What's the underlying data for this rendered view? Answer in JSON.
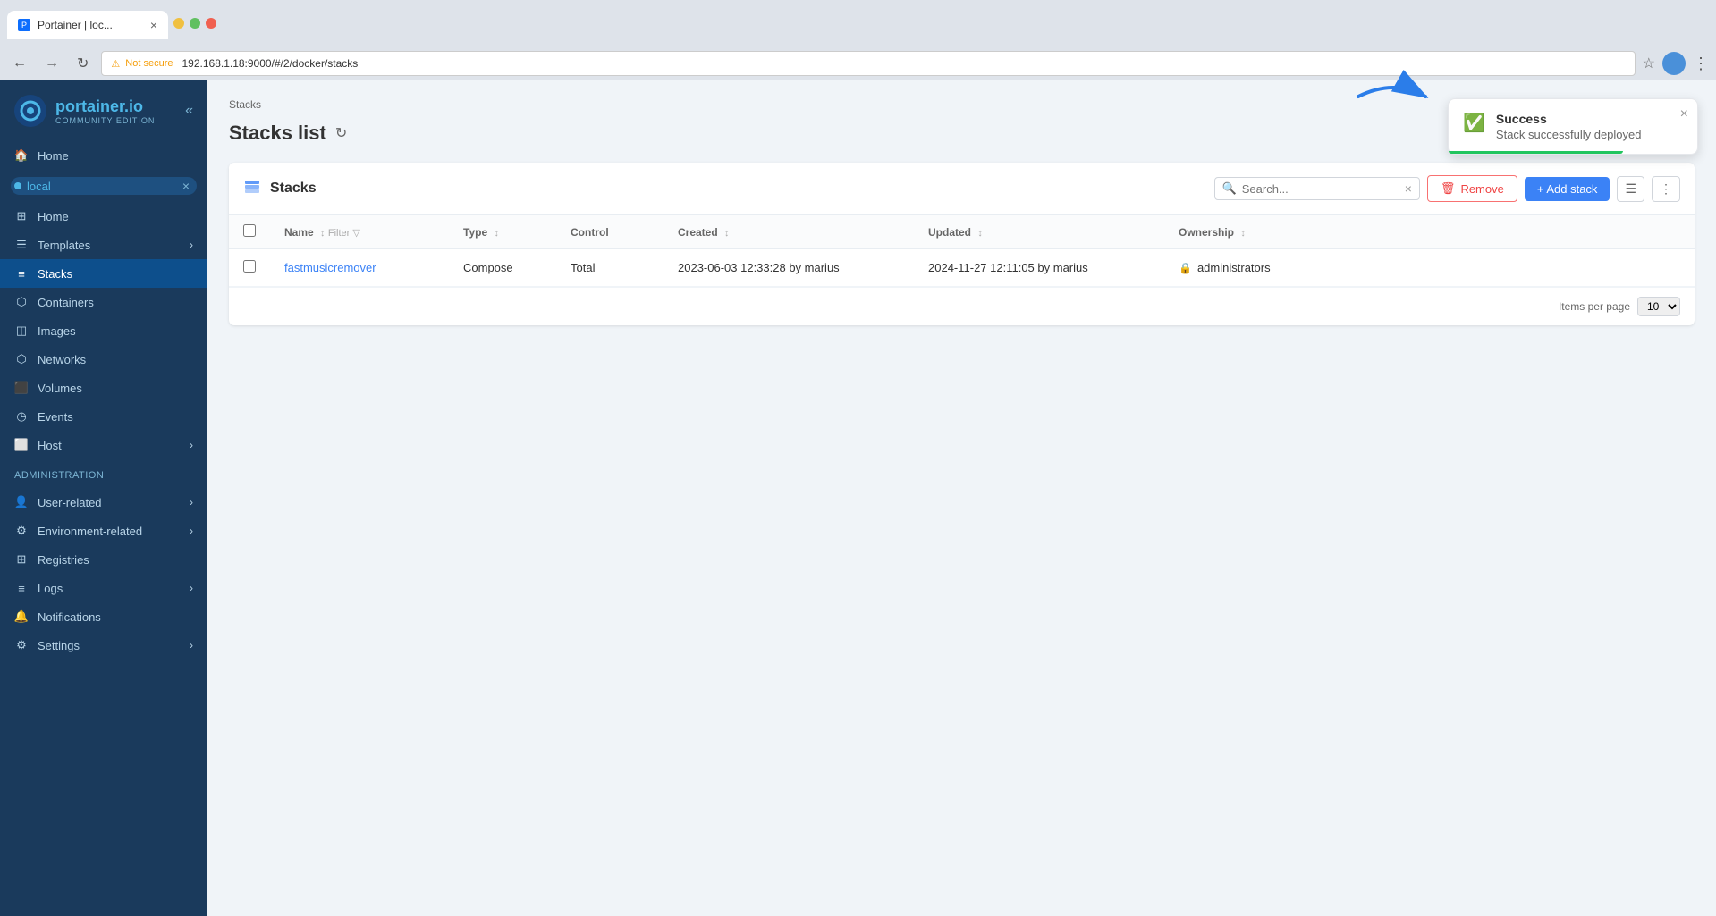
{
  "browser": {
    "tab_title": "Portainer | loc...",
    "url": "192.168.1.18:9000/#/2/docker/stacks",
    "security_label": "Not secure"
  },
  "sidebar": {
    "logo_name": "portainer.io",
    "logo_sub": "Community Edition",
    "env_name": "local",
    "home_label": "Home",
    "templates_label": "Templates",
    "stacks_label": "Stacks",
    "containers_label": "Containers",
    "images_label": "Images",
    "networks_label": "Networks",
    "volumes_label": "Volumes",
    "events_label": "Events",
    "host_label": "Host",
    "admin_label": "Administration",
    "user_related_label": "User-related",
    "env_related_label": "Environment-related",
    "registries_label": "Registries",
    "logs_label": "Logs",
    "notifications_label": "Notifications",
    "settings_label": "Settings"
  },
  "page": {
    "breadcrumb": "Stacks",
    "title": "Stacks list"
  },
  "panel": {
    "title": "Stacks",
    "search_placeholder": "Search...",
    "remove_label": "Remove",
    "add_stack_label": "+ Add stack",
    "items_per_page_label": "Items per page",
    "items_per_page_value": "10"
  },
  "table": {
    "columns": [
      "",
      "Name",
      "Type",
      "Control",
      "Created",
      "Updated",
      "Ownership"
    ],
    "rows": [
      {
        "name": "fastmusicremover",
        "type": "Compose",
        "control": "Total",
        "created": "2023-06-03 12:33:28 by marius",
        "updated": "2024-11-27 12:11:05 by marius",
        "ownership": "administrators"
      }
    ]
  },
  "toast": {
    "title": "Success",
    "message": "Stack successfully deployed",
    "close_label": "×"
  }
}
